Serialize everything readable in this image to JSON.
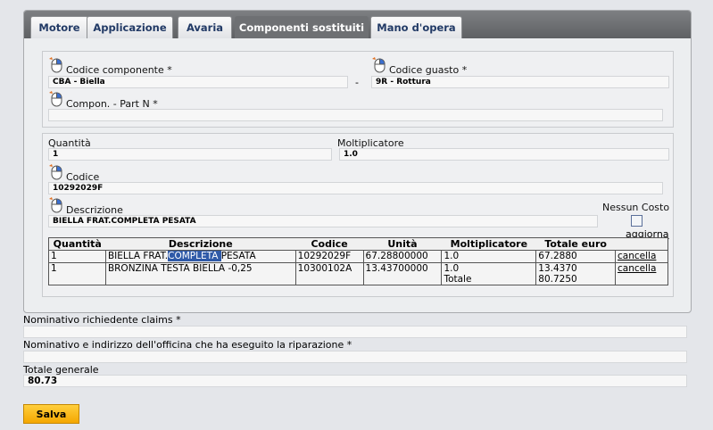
{
  "tabs": [
    {
      "label": "Motore",
      "active": false
    },
    {
      "label": "Applicazione",
      "active": false
    },
    {
      "label": "Avaria",
      "active": false
    },
    {
      "label": "Componenti sostituiti",
      "active": true
    },
    {
      "label": "Mano d'opera",
      "active": false
    }
  ],
  "component": {
    "codice_componente_label": "Codice componente *",
    "codice_componente_value": "CBA - Biella",
    "separator": "-",
    "codice_guasto_label": "Codice guasto *",
    "codice_guasto_value": "9R - Rottura",
    "part_n_label": "Compon. - Part N *",
    "part_n_value": ""
  },
  "entry": {
    "quantita_label": "Quantità",
    "quantita_value": "1",
    "moltiplicatore_label": "Moltiplicatore",
    "moltiplicatore_value": "1.0",
    "codice_label": "Codice",
    "codice_value": "10292029F",
    "descrizione_label": "Descrizione",
    "descrizione_value": "BIELLA FRAT.COMPLETA PESATA",
    "nessun_costo_label": "Nessun Costo",
    "aggiorna_label": "aggiorna"
  },
  "table": {
    "headers": [
      "Quantità",
      "Descrizione",
      "Codice",
      "Unità",
      "Moltiplicatore",
      "Totale euro"
    ],
    "rows": [
      {
        "qty": "1",
        "desc_pre": "BIELLA FRAT.",
        "desc_sel": "COMPLETA ",
        "desc_post": "PESATA",
        "codice": "10292029F",
        "unita": "67.28800000",
        "molt": "1.0",
        "totale": "67.2880",
        "action": "cancella"
      },
      {
        "qty": "1",
        "desc": "BRONZINA TESTA BIELLA -0,25",
        "codice": "10300102A",
        "unita": "13.43700000",
        "molt": "1.0",
        "totale": "13.4370",
        "action": "cancella"
      }
    ],
    "total_label": "Totale",
    "total_value": "80.7250"
  },
  "footer": {
    "richiedente_label": "Nominativo richiedente claims *",
    "richiedente_value": "",
    "officina_label": "Nominativo e indirizzo dell'officina che ha eseguito la riparazione *",
    "officina_value": "",
    "totale_generale_label": "Totale generale",
    "totale_generale_value": "80.73",
    "save_label": "Salva"
  },
  "colors": {
    "accent_button": "#f4a700",
    "tab_active": "#6e7073",
    "tab_text": "#223a66",
    "selection": "#2f5aa8"
  }
}
